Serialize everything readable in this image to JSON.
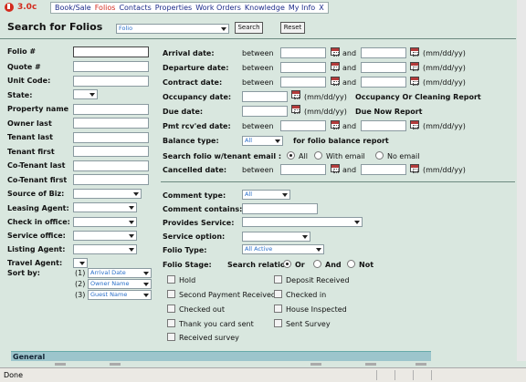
{
  "app": {
    "version": "3.0c"
  },
  "menu": [
    "Book/Sale",
    "Folios",
    "Contacts",
    "Properties",
    "Work Orders",
    "Knowledge",
    "My Info",
    "X"
  ],
  "menu_active": "Folios",
  "title": "Search for Folios",
  "header_select": "Folio",
  "buttons": {
    "search": "Search",
    "reset": "Reset"
  },
  "left_fields": {
    "folio": "Folio #",
    "quote": "Quote #",
    "unit_code": "Unit Code:",
    "state": "State:",
    "property_name": "Property name",
    "owner_last": "Owner last",
    "tenant_last": "Tenant last",
    "tenant_first": "Tenant first",
    "cotenant_last": "Co-Tenant last",
    "cotenant_first": "Co-Tenant first",
    "source_biz": "Source of Biz:",
    "leasing_agent": "Leasing Agent:",
    "check_in_office": "Check in office:",
    "service_office": "Service office:",
    "listing_agent": "Listing Agent:",
    "travel_agent": "Travel Agent:",
    "sort_by": "Sort by:"
  },
  "sort": {
    "n1": "(1)",
    "n2": "(2)",
    "n3": "(3)",
    "v1": "Arrival Date",
    "v2": "Owner Name",
    "v3": "Guest Name"
  },
  "dates": {
    "arrival": "Arrival date:",
    "departure": "Departure date:",
    "contract": "Contract date:",
    "occupancy": "Occupancy date:",
    "due": "Due date:",
    "pmt": "Pmt rcv'ed date:",
    "between": "between",
    "and": "and",
    "fmt": "(mm/dd/yy)",
    "occupancy_report": "Occupancy Or Cleaning Report",
    "due_report": "Due Now Report",
    "cancelled": "Cancelled date:"
  },
  "balance": {
    "label": "Balance type:",
    "value": "All",
    "note": "for folio balance report"
  },
  "tenant_email": {
    "label": "Search folio w/tenant email :",
    "all": "All",
    "with": "With email",
    "no": "No email"
  },
  "comment_type": {
    "label": "Comment type:",
    "value": "All"
  },
  "comment_contains": "Comment contains:",
  "provides_service": "Provides Service:",
  "service_option": "Service option:",
  "folio_type": {
    "label": "Folio Type:",
    "value": "All Active"
  },
  "folio_stage": {
    "label": "Folio Stage:",
    "relation": "Search relation",
    "or": "Or",
    "and": "And",
    "not": "Not"
  },
  "stages_left": [
    "Hold",
    "Second Payment Received",
    "Checked out",
    "Thank you card sent",
    "Received survey"
  ],
  "stages_right": [
    "Deposit Received",
    "Checked in",
    "House Inspected",
    "Sent Survey"
  ],
  "section_general": "General",
  "status": "Done",
  "colors": {
    "brand_red": "#d32b1e",
    "bg": "#d9e7df",
    "select_text": "#2a6fc9"
  }
}
